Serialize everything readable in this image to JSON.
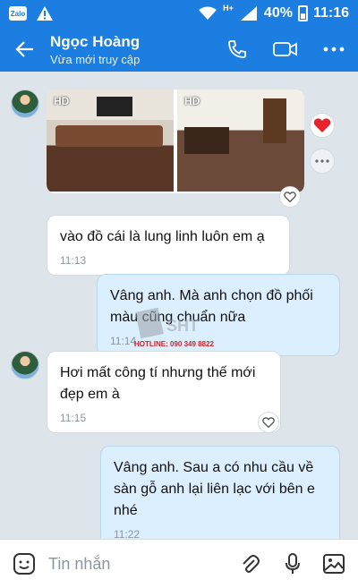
{
  "status_bar": {
    "app_badge": "Zalo",
    "network": "H+",
    "battery": "40%",
    "time": "11:16"
  },
  "header": {
    "name": "Ngọc Hoàng",
    "status": "Vừa mới truy cập"
  },
  "chat": {
    "photos": {
      "hd_label_1": "HD",
      "hd_label_2": "HD"
    },
    "messages": [
      {
        "text": "vào đồ cái là lung linh luôn em ạ",
        "time": "11:13"
      },
      {
        "text": "Vâng anh. Mà anh chọn đồ phối màu cũng chuẩn nữa",
        "time": "11:14"
      },
      {
        "text": "Hơi mất công tí nhưng thế mới đẹp em à",
        "time": "11:15"
      },
      {
        "text": "Vâng anh. Sau a có nhu cầu về sàn gỗ anh lại liên lạc với bên e nhé",
        "time": "11:22"
      }
    ],
    "watermark_hotline": "HOTLINE: 090 349 8822"
  },
  "composer": {
    "placeholder": "Tin nhắn"
  },
  "colors": {
    "brand": "#1b7ee0",
    "mine_bubble": "#dcefff",
    "background": "#dde4ea"
  },
  "icons": [
    "back-arrow-icon",
    "phone-icon",
    "video-icon",
    "more-icon",
    "heart-icon",
    "sticker-icon",
    "attach-icon",
    "mic-icon",
    "image-icon"
  ]
}
